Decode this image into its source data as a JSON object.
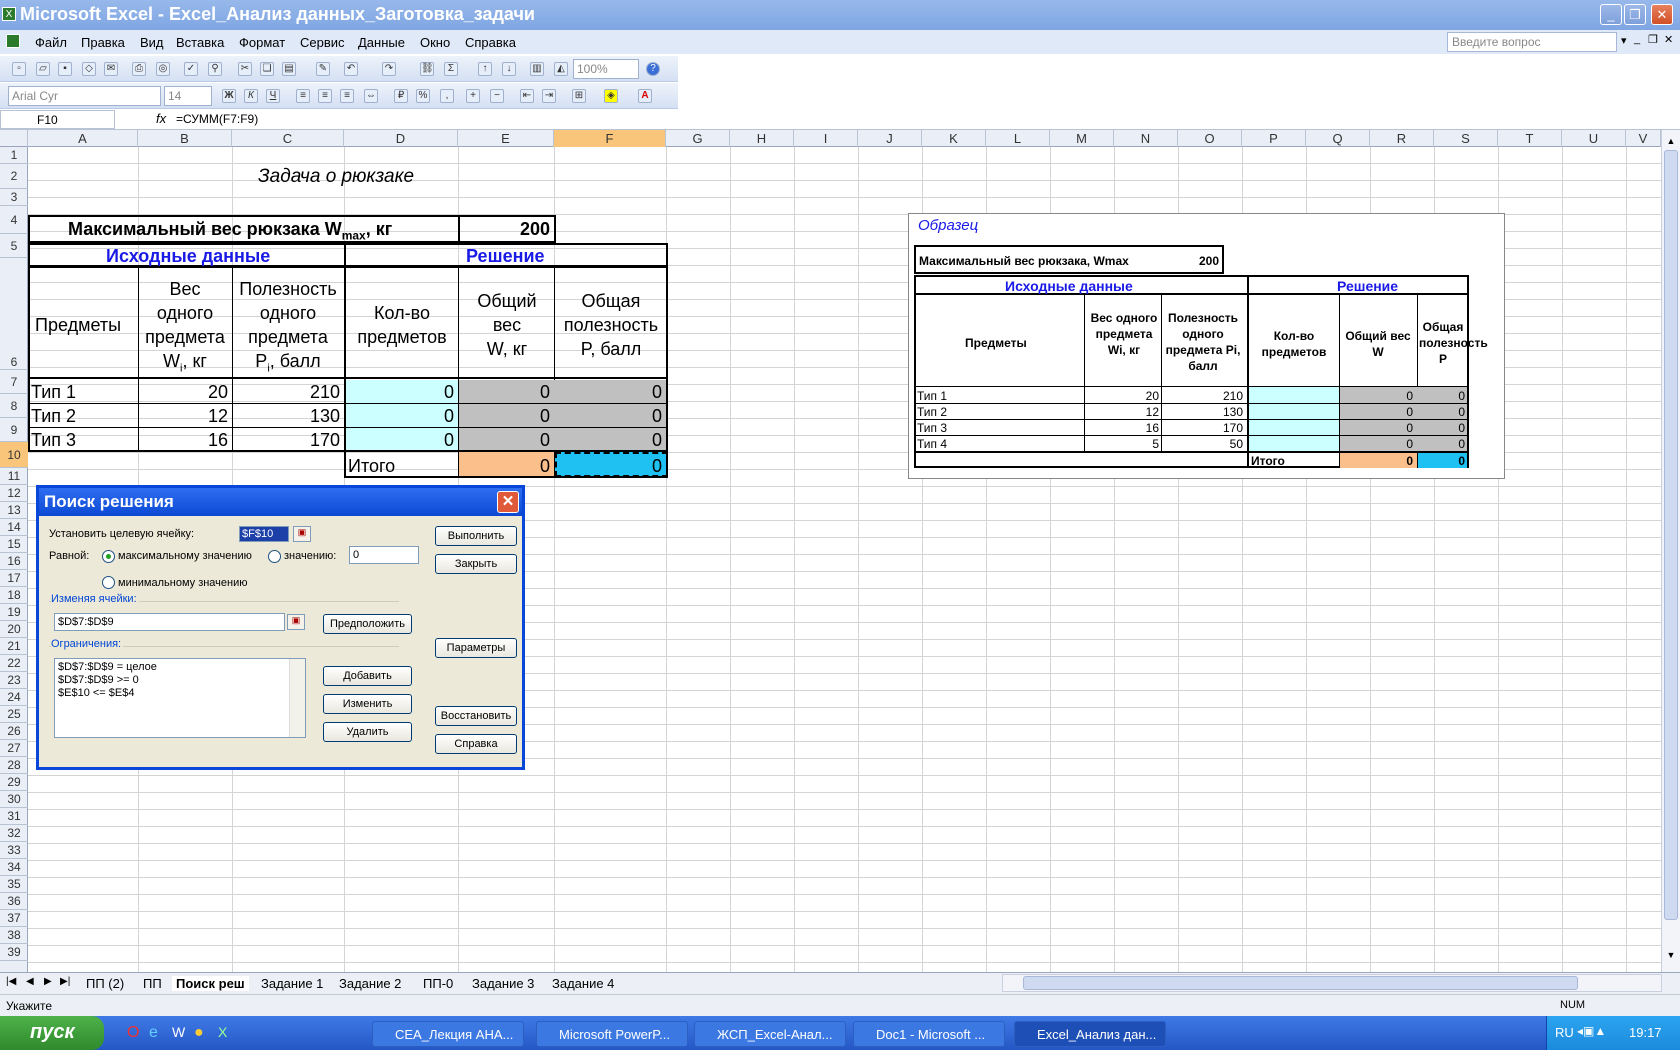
{
  "app": {
    "title": "Microsoft Excel - Excel_Анализ данных_Заготовка_задачи",
    "icon": "excel-icon"
  },
  "menu": [
    "Файл",
    "Правка",
    "Вид",
    "Вставка",
    "Формат",
    "Сервис",
    "Данные",
    "Окно",
    "Справка"
  ],
  "help_placeholder": "Введите вопрос",
  "toolbar": {
    "zoom": "100%",
    "font": "Arial Cyr",
    "size": "14"
  },
  "formula_bar": {
    "cell": "F10",
    "fx": "fx",
    "formula": "=СУММ(F7:F9)"
  },
  "columns": [
    "A",
    "B",
    "C",
    "D",
    "E",
    "F",
    "G",
    "H",
    "I",
    "J",
    "K",
    "L",
    "M",
    "N",
    "O",
    "P",
    "Q",
    "R",
    "S",
    "T",
    "U",
    "V"
  ],
  "rows": [
    "1",
    "2",
    "3",
    "4",
    "5",
    "6",
    "7",
    "8",
    "9",
    "10",
    "11",
    "12",
    "13",
    "14",
    "15",
    "16",
    "17",
    "18",
    "19",
    "20",
    "21",
    "22",
    "23",
    "24",
    "25",
    "26",
    "27",
    "28",
    "29",
    "30",
    "31",
    "32",
    "33",
    "34",
    "35",
    "36",
    "37",
    "38",
    "39"
  ],
  "sheet": {
    "title": "Задача о рюкзаке",
    "max_label": "Максимальный вес рюкзака W",
    "max_sub": "max",
    "max_unit": ", кг",
    "max_value": "200",
    "hdr_source": "Исходные данные",
    "hdr_solution": "Решение",
    "col_items": "Предметы",
    "col_weight": [
      "Вес",
      "одного",
      "предмета",
      "W",
      "i",
      ", кг"
    ],
    "col_util": [
      "Полезность",
      "одного",
      "предмета",
      "P",
      "i",
      ", балл"
    ],
    "col_count": [
      "Кол-во",
      "предметов"
    ],
    "col_total_w": [
      "Общий",
      "вес",
      "W, кг"
    ],
    "col_total_p": [
      "Общая",
      "полезность",
      "P, балл"
    ],
    "rows": [
      {
        "name": "Тип 1",
        "w": "20",
        "p": "210",
        "d": "0",
        "e": "0",
        "f": "0"
      },
      {
        "name": "Тип 2",
        "w": "12",
        "p": "130",
        "d": "0",
        "e": "0",
        "f": "0"
      },
      {
        "name": "Тип 3",
        "w": "16",
        "p": "170",
        "d": "0",
        "e": "0",
        "f": "0"
      }
    ],
    "total_label": "Итого",
    "total_e": "0",
    "total_f": "0"
  },
  "sample": {
    "title": "Образец",
    "max_label": "Максимальный вес рюкзака, Wmax",
    "max_value": "200",
    "hdr_source": "Исходные данные",
    "hdr_solution": "Решение",
    "col_items": "Предметы",
    "col_weight": "Вес одного предмета Wi, кг",
    "col_util": "Полезность одного предмета Pi, балл",
    "col_count": "Кол-во предметов",
    "col_total_w": "Общий вес W",
    "col_total_p": "Общая полезность P",
    "rows": [
      {
        "name": "Тип 1",
        "w": "20",
        "p": "210",
        "e": "0",
        "f": "0"
      },
      {
        "name": "Тип 2",
        "w": "12",
        "p": "130",
        "e": "0",
        "f": "0"
      },
      {
        "name": "Тип 3",
        "w": "16",
        "p": "170",
        "e": "0",
        "f": "0"
      },
      {
        "name": "Тип 4",
        "w": "5",
        "p": "50",
        "e": "0",
        "f": "0"
      }
    ],
    "total_label": "Итого",
    "total_e": "0",
    "total_f": "0"
  },
  "dialog": {
    "title": "Поиск решения",
    "target_label": "Установить целевую ячейку:",
    "target_value": "$F$10",
    "equal_label": "Равной:",
    "opt_max": "максимальному значению",
    "opt_value": "значению:",
    "value_field": "0",
    "opt_min": "минимальному значению",
    "changing_label": "Изменяя ячейки:",
    "changing_value": "$D$7:$D$9",
    "constraints_label": "Ограничения:",
    "constraints": [
      "$D$7:$D$9 = целое",
      "$D$7:$D$9 >= 0",
      "$E$10 <= $E$4"
    ],
    "btn_solve": "Выполнить",
    "btn_close": "Закрыть",
    "btn_guess": "Предположить",
    "btn_params": "Параметры",
    "btn_add": "Добавить",
    "btn_change": "Изменить",
    "btn_delete": "Удалить",
    "btn_reset": "Восстановить",
    "btn_help": "Справка"
  },
  "sheet_tabs": [
    "ПП (2)",
    "ПП",
    "Поиск реш",
    "Задание 1",
    "Задание 2",
    "ПП-0",
    "Задание 3",
    "Задание 4"
  ],
  "status": {
    "left": "Укажите",
    "num": "NUM"
  },
  "taskbar": {
    "start": "пуск",
    "items": [
      "СЕА_Лекция АНА...",
      "Microsoft PowerP...",
      "ЖСП_Excel-Анал...",
      "Doc1 - Microsoft ...",
      "Excel_Анализ дан..."
    ],
    "lang": "RU",
    "clock": "19:17"
  }
}
